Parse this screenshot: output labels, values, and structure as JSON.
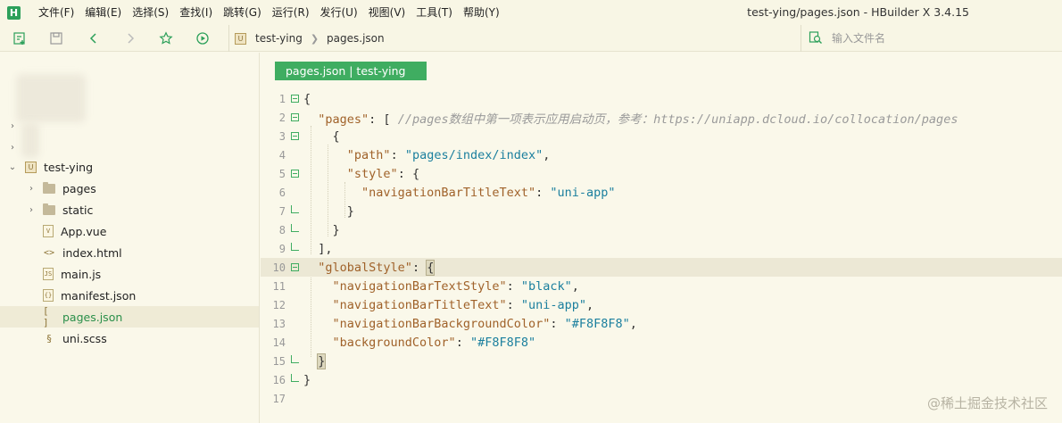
{
  "menu": {
    "logo": "H",
    "items": [
      "文件(F)",
      "编辑(E)",
      "选择(S)",
      "查找(I)",
      "跳转(G)",
      "运行(R)",
      "发行(U)",
      "视图(V)",
      "工具(T)",
      "帮助(Y)"
    ]
  },
  "window": {
    "title": "test-ying/pages.json - HBuilder X 3.4.15"
  },
  "toolbar": {
    "icons": [
      "new-file-icon",
      "save-icon",
      "back-icon",
      "forward-icon",
      "star-icon",
      "run-icon"
    ]
  },
  "breadcrumb": {
    "project_icon": "U",
    "project": "test-ying",
    "file": "pages.json"
  },
  "search": {
    "placeholder": "输入文件名"
  },
  "sidebar": {
    "project": {
      "label": "test-ying",
      "icon": "U"
    },
    "items": [
      {
        "label": "pages",
        "type": "folder"
      },
      {
        "label": "static",
        "type": "folder"
      },
      {
        "label": "App.vue",
        "type": "vue",
        "icon": "V"
      },
      {
        "label": "index.html",
        "type": "html",
        "icon": "<>"
      },
      {
        "label": "main.js",
        "type": "js",
        "icon": "JS"
      },
      {
        "label": "manifest.json",
        "type": "json",
        "icon": "{}"
      },
      {
        "label": "pages.json",
        "type": "bracket",
        "icon": "[ ]",
        "active": true
      },
      {
        "label": "uni.scss",
        "type": "scss",
        "icon": "§"
      }
    ]
  },
  "editor": {
    "tab": "pages.json | test-ying",
    "current_line": 10,
    "lines": [
      {
        "n": "1",
        "fold": "open",
        "tokens": [
          {
            "t": "{",
            "c": "p"
          }
        ]
      },
      {
        "n": "2",
        "fold": "open",
        "tokens": [
          {
            "t": "  ",
            "c": "p"
          },
          {
            "t": "\"pages\"",
            "c": "k"
          },
          {
            "t": ": [ ",
            "c": "p"
          },
          {
            "t": "//pages数组中第一项表示应用启动页，参考：https://uniapp.dcloud.io/collocation/pages",
            "c": "c"
          }
        ]
      },
      {
        "n": "3",
        "fold": "open",
        "tokens": [
          {
            "t": "    {",
            "c": "p"
          }
        ]
      },
      {
        "n": "4",
        "fold": "",
        "tokens": [
          {
            "t": "      ",
            "c": "p"
          },
          {
            "t": "\"path\"",
            "c": "k"
          },
          {
            "t": ": ",
            "c": "p"
          },
          {
            "t": "\"pages/index/index\"",
            "c": "s"
          },
          {
            "t": ",",
            "c": "p"
          }
        ]
      },
      {
        "n": "5",
        "fold": "open",
        "tokens": [
          {
            "t": "      ",
            "c": "p"
          },
          {
            "t": "\"style\"",
            "c": "k"
          },
          {
            "t": ": {",
            "c": "p"
          }
        ]
      },
      {
        "n": "6",
        "fold": "",
        "tokens": [
          {
            "t": "        ",
            "c": "p"
          },
          {
            "t": "\"navigationBarTitleText\"",
            "c": "k"
          },
          {
            "t": ": ",
            "c": "p"
          },
          {
            "t": "\"uni-app\"",
            "c": "s"
          }
        ]
      },
      {
        "n": "7",
        "fold": "end",
        "tokens": [
          {
            "t": "      }",
            "c": "p"
          }
        ]
      },
      {
        "n": "8",
        "fold": "end",
        "tokens": [
          {
            "t": "    }",
            "c": "p"
          }
        ]
      },
      {
        "n": "9",
        "fold": "end",
        "tokens": [
          {
            "t": "  ],",
            "c": "p"
          }
        ]
      },
      {
        "n": "10",
        "fold": "open",
        "tokens": [
          {
            "t": "  ",
            "c": "p"
          },
          {
            "t": "\"globalStyle\"",
            "c": "k"
          },
          {
            "t": ": ",
            "c": "p"
          },
          {
            "t": "{",
            "c": "bm"
          }
        ]
      },
      {
        "n": "11",
        "fold": "",
        "tokens": [
          {
            "t": "    ",
            "c": "p"
          },
          {
            "t": "\"navigationBarTextStyle\"",
            "c": "k"
          },
          {
            "t": ": ",
            "c": "p"
          },
          {
            "t": "\"black\"",
            "c": "s"
          },
          {
            "t": ",",
            "c": "p"
          }
        ]
      },
      {
        "n": "12",
        "fold": "",
        "tokens": [
          {
            "t": "    ",
            "c": "p"
          },
          {
            "t": "\"navigationBarTitleText\"",
            "c": "k"
          },
          {
            "t": ": ",
            "c": "p"
          },
          {
            "t": "\"uni-app\"",
            "c": "s"
          },
          {
            "t": ",",
            "c": "p"
          }
        ]
      },
      {
        "n": "13",
        "fold": "",
        "tokens": [
          {
            "t": "    ",
            "c": "p"
          },
          {
            "t": "\"navigationBarBackgroundColor\"",
            "c": "k"
          },
          {
            "t": ": ",
            "c": "p"
          },
          {
            "t": "\"#F8F8F8\"",
            "c": "s"
          },
          {
            "t": ",",
            "c": "p"
          }
        ]
      },
      {
        "n": "14",
        "fold": "",
        "tokens": [
          {
            "t": "    ",
            "c": "p"
          },
          {
            "t": "\"backgroundColor\"",
            "c": "k"
          },
          {
            "t": ": ",
            "c": "p"
          },
          {
            "t": "\"#F8F8F8\"",
            "c": "s"
          }
        ]
      },
      {
        "n": "15",
        "fold": "end",
        "tokens": [
          {
            "t": "  ",
            "c": "p"
          },
          {
            "t": "}",
            "c": "bm"
          }
        ]
      },
      {
        "n": "16",
        "fold": "end",
        "tokens": [
          {
            "t": "}",
            "c": "p"
          }
        ]
      },
      {
        "n": "17",
        "fold": "",
        "tokens": []
      }
    ]
  },
  "watermark": "@稀土掘金技术社区",
  "colors": {
    "accent": "#3FAD61",
    "background": "#FAF8EA",
    "key": "#A0622A",
    "string": "#1B7F9E",
    "comment": "#9A9A9A"
  }
}
